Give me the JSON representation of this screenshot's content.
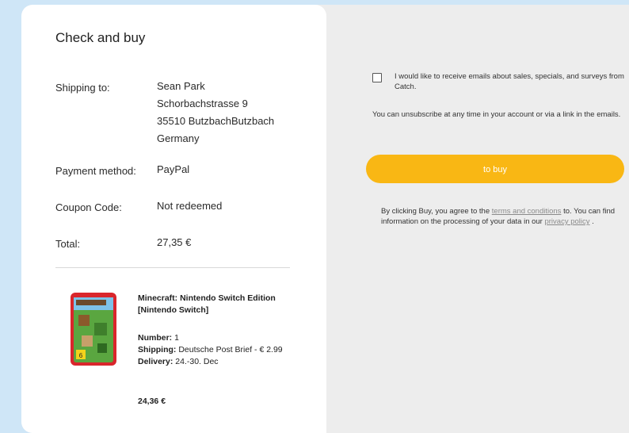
{
  "summary": {
    "title": "Check and buy",
    "shipping_label": "Shipping to:",
    "shipping_name": "Sean Park",
    "shipping_street": "Schorbachstrasse 9",
    "shipping_city": "35510 ButzbachButzbach",
    "shipping_country": "Germany",
    "payment_label": "Payment method:",
    "payment_value": "PayPal",
    "coupon_label": "Coupon Code:",
    "coupon_value": "Not redeemed",
    "total_label": "Total:",
    "total_value": "27,35 €"
  },
  "product": {
    "title": "Minecraft: Nintendo Switch Edition [Nintendo Switch]",
    "number_label": "Number:",
    "number_value": " 1",
    "shipping_label": "Shipping:",
    "shipping_value": " Deutsche Post Brief - € 2.99",
    "delivery_label": "Delivery:",
    "delivery_value": " 24.-30. Dec",
    "price": "24,36 €",
    "image_icon": "game-box-icon",
    "age_rating": "6"
  },
  "checkout": {
    "newsletter_text": "I would like to receive emails about sales, specials, and surveys from Catch.",
    "unsubscribe_text": "You can unsubscribe at any time in your account or via a link in the emails.",
    "buy_label": "to buy",
    "agree_prefix": "By clicking Buy, you agree to the ",
    "terms_link": "terms and conditions",
    "agree_middle": " to. You can find information on the processing of your data in our ",
    "privacy_link": "privacy policy",
    "agree_suffix": " ."
  },
  "colors": {
    "accent": "#f9b714",
    "background": "#cfe6f7",
    "panel": "#ededed"
  }
}
